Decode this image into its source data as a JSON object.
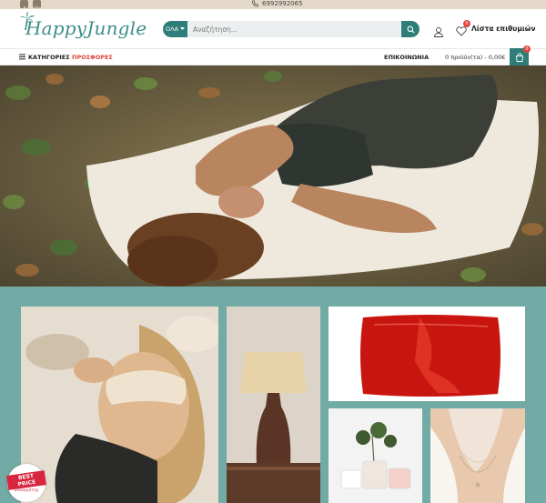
{
  "topbar": {
    "phone": "6992992065",
    "social": [
      "facebook-icon",
      "instagram-icon"
    ]
  },
  "header": {
    "logo_text": "HappyJungle",
    "search": {
      "category_label": "ΟΛΑ",
      "placeholder": "Αναζήτηση..."
    },
    "wishlist_label": "Λίστα επιθυμιών",
    "wishlist_count": "0"
  },
  "nav": {
    "categories_label": "ΚΑΤΗΓΟΡΙΕΣ",
    "offers_label": "ΠΡΟΣΦΟΡΕΣ",
    "contact_label": "ΕΠΙΚΟΙΝΩΝΙΑ",
    "cart_summary": "0 προϊόν(τα) - 0,00€",
    "cart_count": "0"
  },
  "colors": {
    "brand_teal": "#2e7d78",
    "section_bg": "#72aaa6",
    "offers_red": "#e0443b",
    "topbar_bg": "#e4d9c8"
  },
  "partner_badge": {
    "title": "BEST PRICE",
    "subtitle": "Συνεργάτης"
  }
}
